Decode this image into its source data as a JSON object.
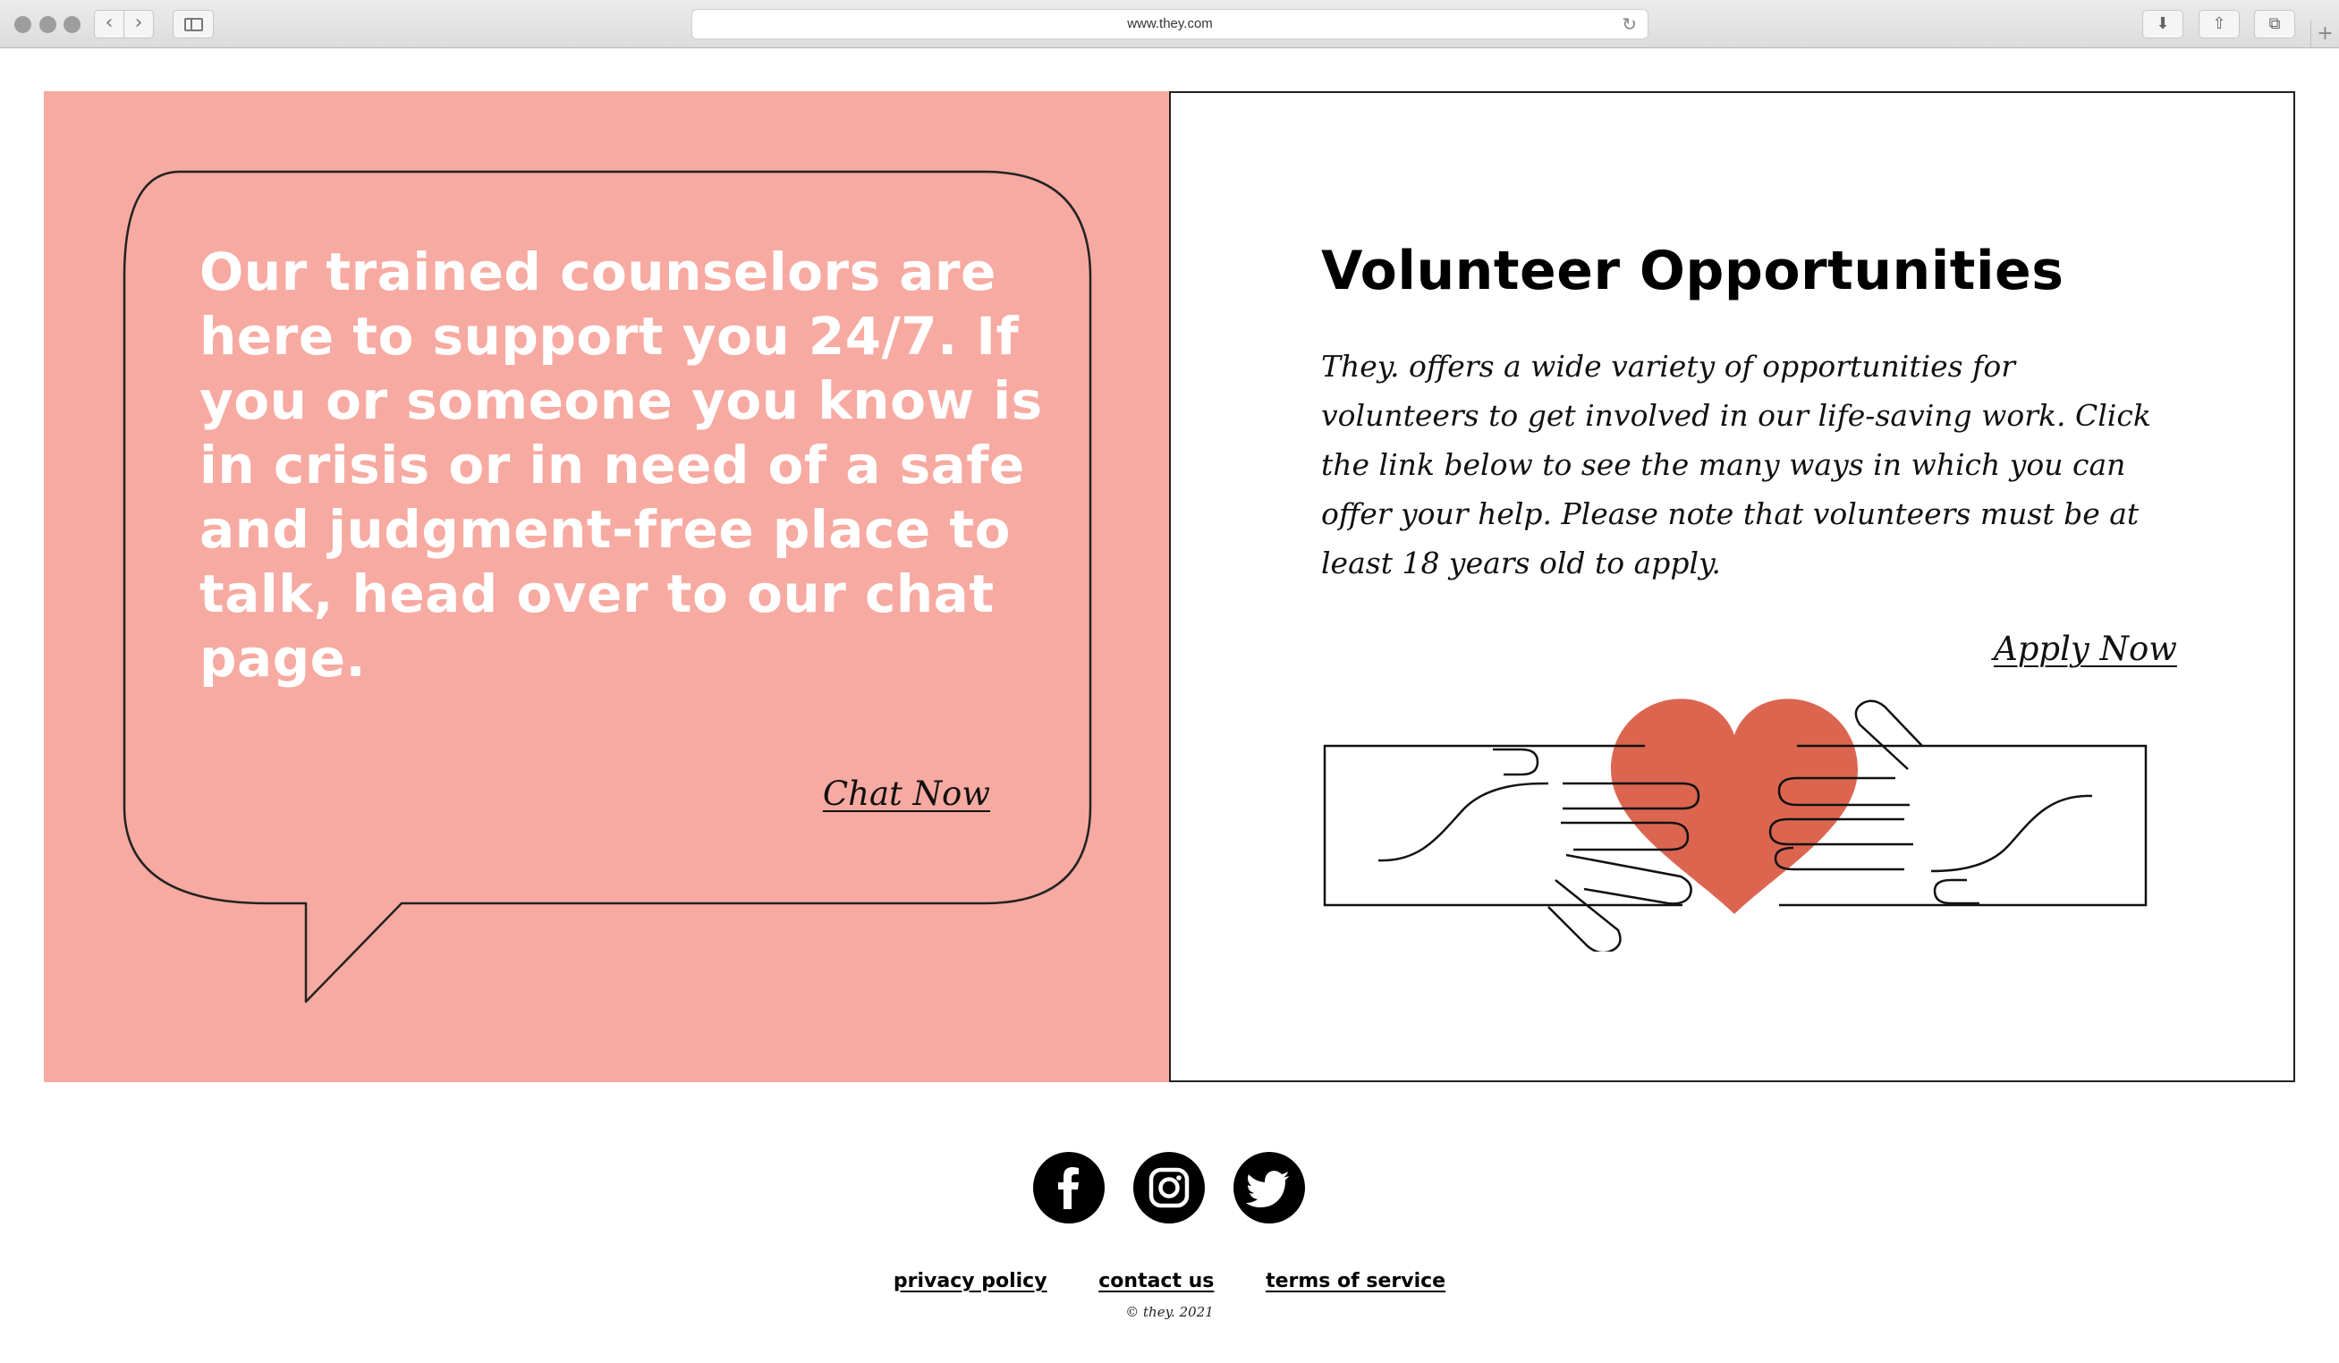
{
  "browser": {
    "url": "www.they.com",
    "back_glyph": "‹",
    "forward_glyph": "›",
    "reload_glyph": "↻",
    "download_glyph": "⬇",
    "share_glyph": "⇧",
    "tabs_glyph": "⧉",
    "new_tab_glyph": "+"
  },
  "chat_card": {
    "message": "Our trained counselors are here to support you 24/7. If you or someone you know is in crisis or in need of a safe and judgment-free place to talk, head over to our chat page.",
    "link_label": "Chat Now",
    "background_color": "#f7aaa1"
  },
  "volunteer_card": {
    "title": "Volunteer Opportunities",
    "body": "They. offers a wide variety of opportunities for volunteers to get involved in our life-saving work. Click the link below to see the many ways in which you can offer your help. Please note that volunteers must be at least 18 years old to apply.",
    "link_label": "Apply Now",
    "illustration": "hands-holding-heart-icon",
    "heart_color": "#dc6550"
  },
  "footer": {
    "social": [
      {
        "name": "facebook-icon"
      },
      {
        "name": "instagram-icon"
      },
      {
        "name": "twitter-icon"
      }
    ],
    "links": {
      "privacy": "privacy policy",
      "contact": "contact us",
      "terms": "terms of service"
    },
    "copyright": "© they. 2021"
  }
}
